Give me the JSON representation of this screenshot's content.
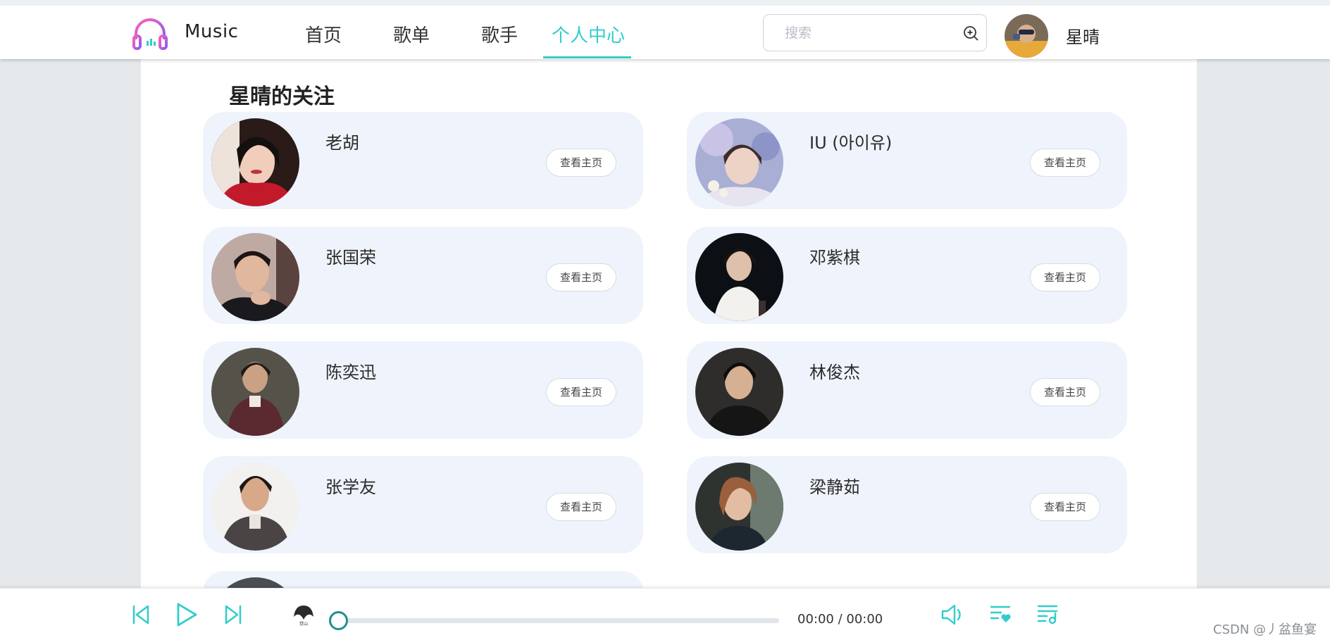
{
  "header": {
    "app_name": "Music",
    "nav": [
      {
        "label": "首页"
      },
      {
        "label": "歌单"
      },
      {
        "label": "歌手"
      },
      {
        "label": "个人中心",
        "active": true
      }
    ],
    "search": {
      "placeholder": "搜索",
      "value": ""
    },
    "user": {
      "name": "星晴"
    }
  },
  "main": {
    "title": "星晴的关注",
    "follow_button_label": "查看主页",
    "artists": [
      {
        "name": "老胡"
      },
      {
        "name": "IU (아이유)"
      },
      {
        "name": "张国荣"
      },
      {
        "name": "邓紫棋"
      },
      {
        "name": "陈奕迅"
      },
      {
        "name": "林俊杰"
      },
      {
        "name": "张学友"
      },
      {
        "name": "梁静茹"
      }
    ]
  },
  "player": {
    "time": "00:00 / 00:00",
    "progress": 0,
    "album_caption": "觉山",
    "icons": [
      "skip-previous-icon",
      "play-icon",
      "skip-next-icon",
      "volume-icon",
      "favorite-list-icon",
      "playlist-icon"
    ]
  },
  "watermark": "CSDN @丿盆鱼宴",
  "colors": {
    "accent": "#33cccc",
    "logo_gradient_start": "#ff5fb8",
    "logo_gradient_end": "#8b5cf6",
    "card_bg": "#eff3fb",
    "page_bg": "#e5e9ec"
  }
}
